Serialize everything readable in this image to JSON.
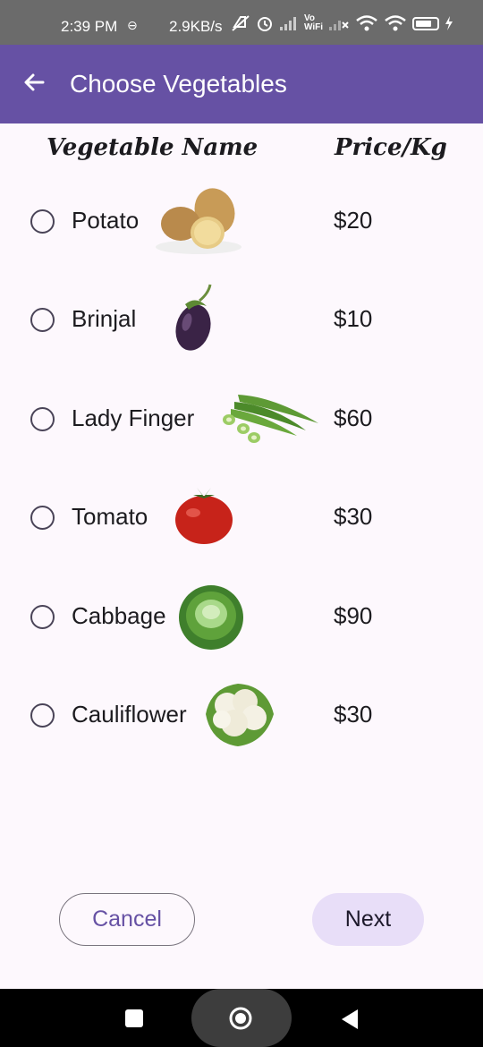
{
  "status_bar": {
    "time": "2:39 PM",
    "speed": "2.9KB/s",
    "wifi_label_top": "Vo",
    "wifi_label_bottom": "WiFi"
  },
  "app_bar": {
    "title": "Choose Vegetables"
  },
  "table": {
    "col_name": "Vegetable Name",
    "col_price": "Price/Kg"
  },
  "vegetables": [
    {
      "name": "Potato",
      "price": "$20",
      "icon": "potato-icon"
    },
    {
      "name": "Brinjal",
      "price": "$10",
      "icon": "brinjal-icon"
    },
    {
      "name": "Lady Finger",
      "price": "$60",
      "icon": "lady-finger-icon"
    },
    {
      "name": "Tomato",
      "price": "$30",
      "icon": "tomato-icon"
    },
    {
      "name": "Cabbage",
      "price": "$90",
      "icon": "cabbage-icon"
    },
    {
      "name": "Cauliflower",
      "price": "$30",
      "icon": "cauliflower-icon"
    }
  ],
  "buttons": {
    "cancel": "Cancel",
    "next": "Next"
  },
  "colors": {
    "app_bar": "#6651a4",
    "primary": "#6651a4",
    "tonal_button": "#e8def8",
    "status_bar": "#6b6b6b",
    "background": "#fdf8fd"
  }
}
